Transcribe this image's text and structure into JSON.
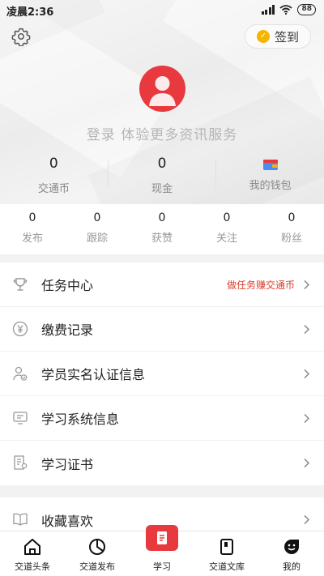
{
  "status_bar": {
    "time": "凌晨2:36",
    "battery": "88"
  },
  "header": {
    "checkin_label": "签到",
    "login_prompt": "登录 体验更多资讯服务"
  },
  "account": {
    "items": [
      {
        "value": "0",
        "label": "交通币"
      },
      {
        "value": "0",
        "label": "现金"
      },
      {
        "value": "",
        "label": "我的钱包",
        "icon": "wallet-icon"
      }
    ]
  },
  "social": {
    "items": [
      {
        "value": "0",
        "label": "发布"
      },
      {
        "value": "0",
        "label": "跟踪"
      },
      {
        "value": "0",
        "label": "获赞"
      },
      {
        "value": "0",
        "label": "关注"
      },
      {
        "value": "0",
        "label": "粉丝"
      }
    ]
  },
  "menu_group_1": [
    {
      "label": "任务中心",
      "extra": "做任务赚交通币",
      "icon": "trophy-icon"
    },
    {
      "label": "缴费记录",
      "extra": "",
      "icon": "yen-icon"
    },
    {
      "label": "学员实名认证信息",
      "extra": "",
      "icon": "user-verify-icon"
    },
    {
      "label": "学习系统信息",
      "extra": "",
      "icon": "monitor-icon"
    },
    {
      "label": "学习证书",
      "extra": "",
      "icon": "certificate-icon"
    }
  ],
  "menu_group_2": [
    {
      "label": "收藏喜欢",
      "extra": "",
      "icon": "book-icon"
    }
  ],
  "tabbar": [
    {
      "label": "交道头条",
      "icon": "home-icon"
    },
    {
      "label": "交道发布",
      "icon": "pie-chart-icon"
    },
    {
      "label": "学习",
      "icon": "study-icon",
      "active": true
    },
    {
      "label": "交道文库",
      "icon": "library-icon"
    },
    {
      "label": "我的",
      "icon": "smiley-icon"
    }
  ],
  "colors": {
    "accent": "#e8393f",
    "promo_text": "#d8402c",
    "checkin_gold": "#f4b400"
  }
}
